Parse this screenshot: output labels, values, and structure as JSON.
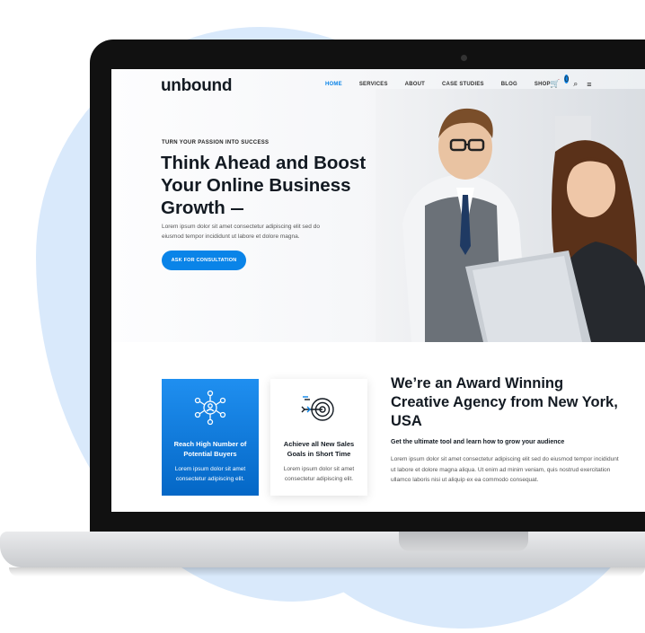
{
  "nav": {
    "logo": "unbound",
    "menu": [
      "HOME",
      "SERVICES",
      "ABOUT",
      "CASE STUDIES",
      "BLOG",
      "SHOP"
    ],
    "cart_count": "0"
  },
  "hero": {
    "eyebrow": "TURN YOUR PASSION INTO SUCCESS",
    "title": "Think Ahead and Boost Your Online Business Growth",
    "text": "Lorem ipsum dolor sit amet consectetur adipiscing elit sed do eiusmod tempor incididunt ut labore et dolore magna.",
    "cta_label": "ASK FOR CONSULTATION"
  },
  "cards": [
    {
      "title": "Reach High Number of Potential Buyers",
      "text": "Lorem ipsum dolor sit amet consectetur adipiscing elit.",
      "icon": "network-user-icon"
    },
    {
      "title": "Achieve all New Sales Goals in Short Time",
      "text": "Lorem ipsum dolor sit amet consectetur adipiscing elit.",
      "icon": "target-arrow-icon"
    }
  ],
  "about": {
    "title": "We’re an Award Winning Creative Agency from New York, USA",
    "subtitle": "Get the ultimate tool and learn how to grow your audience",
    "text": "Lorem ipsum dolor sit amet consectetur adipiscing elit sed do eiusmod tempor incididunt ut labore et dolore magna aliqua. Ut enim ad minim veniam, quis nostrud exercitation ullamco laboris nisi ut aliquip ex ea commodo consequat."
  },
  "colors": {
    "accent": "#0a84e8",
    "heading": "#131a22",
    "background_blob": "#d9e9fb"
  }
}
